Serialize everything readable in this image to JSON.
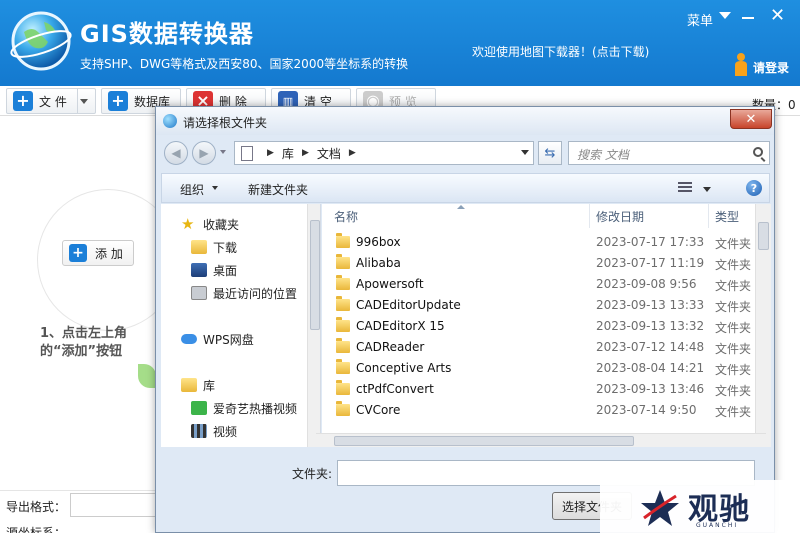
{
  "app": {
    "title": "GIS数据转换器",
    "subtitle": "支持SHP、DWG等格式及西安80、国家2000等坐标系的转换",
    "menu_label": "菜单",
    "welcome": "欢迎使用地图下载器！(点击下载)",
    "login_label": "请登录",
    "close_glyph": "✕"
  },
  "toolbar": {
    "file_label": "文 件",
    "database_label": "数据库",
    "delete_label": "删 除",
    "clear_label": "清 空",
    "preview_label": "预 览",
    "count_label": "数量：0"
  },
  "left": {
    "add_label": "添 加",
    "hint_line1": "1、点击左上角",
    "hint_line2": "的“添加”按钮",
    "export_format_label": "导出格式：",
    "source_crs_label": "源坐标系："
  },
  "dialog": {
    "title": "请选择根文件夹",
    "close_glyph": "✕",
    "breadcrumb": [
      "库",
      "文档"
    ],
    "search_placeholder": "搜索 文档",
    "organize_label": "组织",
    "new_folder_label": "新建文件夹",
    "nav_items": [
      {
        "label": "收藏夹",
        "icon": "star-icon"
      },
      {
        "label": "下载",
        "icon": "download-folder-icon"
      },
      {
        "label": "桌面",
        "icon": "desktop-icon"
      },
      {
        "label": "最近访问的位置",
        "icon": "recent-places-icon"
      },
      {
        "label": "WPS网盘",
        "icon": "cloud-icon"
      },
      {
        "label": "库",
        "icon": "library-icon"
      },
      {
        "label": "爱奇艺热播视频",
        "icon": "iqiyi-icon"
      },
      {
        "label": "视频",
        "icon": "video-icon"
      }
    ],
    "columns": {
      "name": "名称",
      "date": "修改日期",
      "type": "类型"
    },
    "files": [
      {
        "name": "996box",
        "date": "2023-07-17 17:33",
        "type": "文件夹"
      },
      {
        "name": "Alibaba",
        "date": "2023-07-17 11:19",
        "type": "文件夹"
      },
      {
        "name": "Apowersoft",
        "date": "2023-09-08 9:56",
        "type": "文件夹"
      },
      {
        "name": "CADEditorUpdate",
        "date": "2023-09-13 13:33",
        "type": "文件夹"
      },
      {
        "name": "CADEditorX 15",
        "date": "2023-09-13 13:32",
        "type": "文件夹"
      },
      {
        "name": "CADReader",
        "date": "2023-07-12 14:48",
        "type": "文件夹"
      },
      {
        "name": "Conceptive Arts",
        "date": "2023-08-04 14:21",
        "type": "文件夹"
      },
      {
        "name": "ctPdfConvert",
        "date": "2023-09-13 13:46",
        "type": "文件夹"
      },
      {
        "name": "CVCore",
        "date": "2023-07-14 9:50",
        "type": "文件夹"
      }
    ],
    "folder_label": "文件夹:",
    "folder_value": "",
    "select_label": "选择文件夹"
  },
  "watermark": {
    "text": "观驰",
    "sub": "GUANCHI"
  }
}
